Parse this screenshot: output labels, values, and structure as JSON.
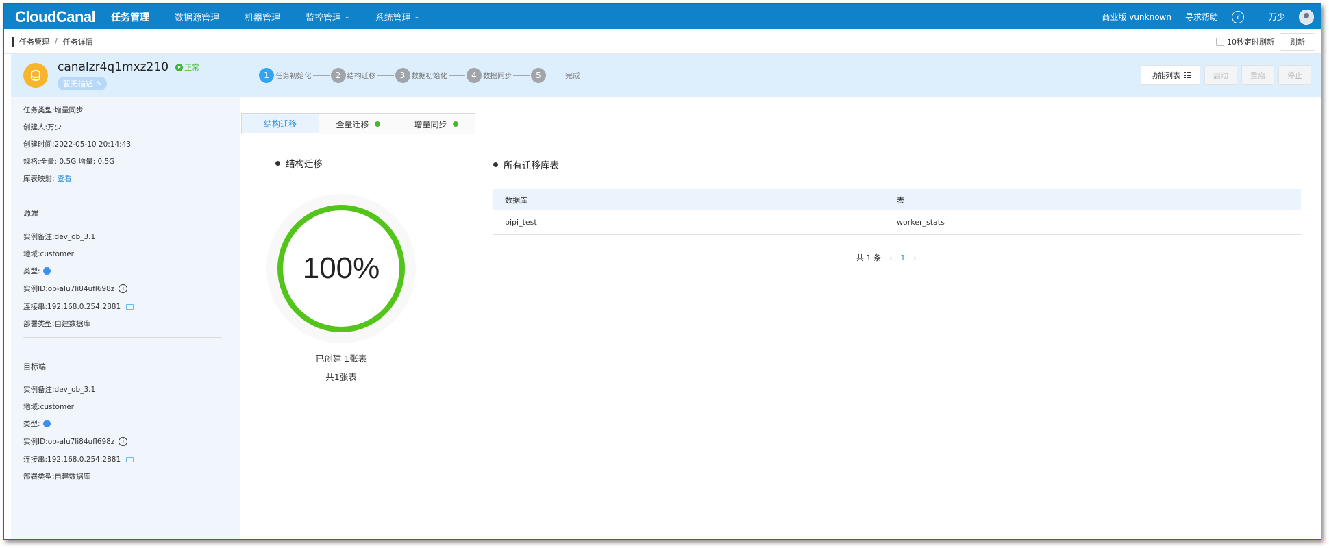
{
  "topnav": {
    "logo": "CloudCanal",
    "items": [
      {
        "label": "任务管理",
        "active": true,
        "dropdown": false
      },
      {
        "label": "数据源管理",
        "active": false,
        "dropdown": false
      },
      {
        "label": "机器管理",
        "active": false,
        "dropdown": false
      },
      {
        "label": "监控管理",
        "active": false,
        "dropdown": true
      },
      {
        "label": "系统管理",
        "active": false,
        "dropdown": true
      }
    ],
    "edition": "商业版 vunknown",
    "help": "寻求帮助",
    "help_icon": "?",
    "user": "万少"
  },
  "breadcrumb": {
    "items": [
      "任务管理",
      "任务详情"
    ],
    "separator": "/",
    "auto_refresh_label": "10秒定时刷新",
    "auto_refresh_checked": false,
    "refresh_button": "刷新"
  },
  "task": {
    "name": "canalzr4q1mxz210",
    "status": "正常",
    "description": "暂无描述",
    "steps": [
      {
        "num": "1",
        "label": "任务初始化",
        "active": true
      },
      {
        "num": "2",
        "label": "结构迁移",
        "active": false
      },
      {
        "num": "3",
        "label": "数据初始化",
        "active": false
      },
      {
        "num": "4",
        "label": "数据同步",
        "active": false
      },
      {
        "num": "5",
        "label": "完成",
        "active": false
      }
    ],
    "buttons": {
      "functions": "功能列表",
      "start": "启动",
      "restart": "重启",
      "stop": "停止"
    }
  },
  "sidebar": {
    "info": {
      "type_label": "任务类型:",
      "type_value": "增量同步",
      "creator_label": "创建人:",
      "creator_value": "万少",
      "created_label": "创建时间:",
      "created_value": "2022-05-10 20:14:43",
      "spec_label": "规格:",
      "spec_value": "全量: 0.5G 增量: 0.5G",
      "mapping_label": "库表映射:",
      "mapping_link": "查看"
    },
    "source": {
      "title": "源端",
      "remark_label": "实例备注:",
      "remark_value": "dev_ob_3.1",
      "region_label": "地域:",
      "region_value": "customer",
      "type_label": "类型:",
      "id_label": "实例ID:",
      "id_value": "ob-alu7li84ufl698z",
      "conn_label": "连接串:",
      "conn_value": "192.168.0.254:2881",
      "deploy_label": "部署类型:",
      "deploy_value": "自建数据库"
    },
    "target": {
      "title": "目标端",
      "remark_label": "实例备注:",
      "remark_value": "dev_ob_3.1",
      "region_label": "地域:",
      "region_value": "customer",
      "type_label": "类型:",
      "id_label": "实例ID:",
      "id_value": "ob-alu7li84ufl698z",
      "conn_label": "连接串:",
      "conn_value": "192.168.0.254:2881",
      "deploy_label": "部署类型:",
      "deploy_value": "自建数据库"
    }
  },
  "tabs": [
    {
      "label": "结构迁移",
      "active": true,
      "dot": false
    },
    {
      "label": "全量迁移",
      "active": false,
      "dot": true
    },
    {
      "label": "增量同步",
      "active": false,
      "dot": true
    }
  ],
  "structure": {
    "title": "结构迁移",
    "progress_text": "100%",
    "progress_fraction": 1.0,
    "created_text": "已创建 1张表",
    "total_text": "共1张表"
  },
  "tables": {
    "title": "所有迁移库表",
    "columns": [
      "数据库",
      "表"
    ],
    "rows": [
      {
        "db": "pipi_test",
        "table": "worker_stats"
      }
    ],
    "total": "共 1 条",
    "page": "1"
  },
  "colors": {
    "nav": "#1082c9",
    "progress": "#52c41a",
    "accent": "#2b8be0",
    "status": "#41b92a"
  }
}
